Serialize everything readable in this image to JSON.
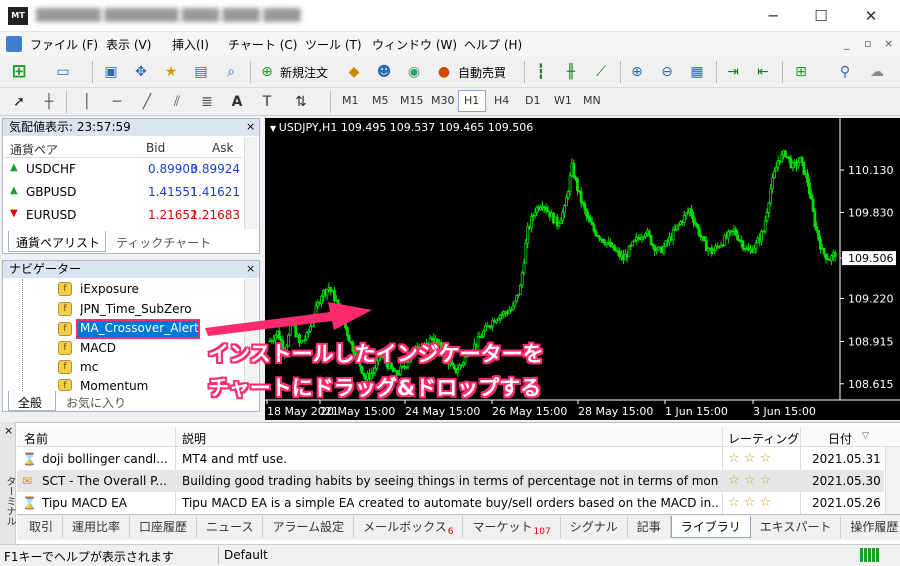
{
  "window": {
    "minimize": "─",
    "maximize": "☐",
    "close": "✕"
  },
  "menu": [
    "ファイル (F)",
    "表示 (V)",
    "挿入(I)",
    "チャート (C)",
    "ツール (T)",
    "ウィンドウ (W)",
    "ヘルプ (H)"
  ],
  "mdi": [
    "_",
    "▫",
    "×"
  ],
  "toolbar": {
    "new_order": "新規注文",
    "auto_trade": "自動売買"
  },
  "timeframes": [
    "M1",
    "M5",
    "M15",
    "M30",
    "H1",
    "H4",
    "D1",
    "W1",
    "MN"
  ],
  "active_timeframe": "H1",
  "market_watch": {
    "title": "気配値表示: 23:57:59",
    "col_pair": "通貨ペア",
    "col_bid": "Bid",
    "col_ask": "Ask",
    "rows": [
      {
        "pair": "USDCHF",
        "bid": "0.89903",
        "ask": "0.89924",
        "dir": "up"
      },
      {
        "pair": "GBPUSD",
        "bid": "1.41551",
        "ask": "1.41621",
        "dir": "up"
      },
      {
        "pair": "EURUSD",
        "bid": "1.21652",
        "ask": "1.21683",
        "dir": "down"
      }
    ],
    "tab1": "通貨ペアリスト",
    "tab2": "ティックチャート"
  },
  "navigator": {
    "title": "ナビゲーター",
    "items": [
      "iExposure",
      "JPN_Time_SubZero",
      "MA_Crossover_Alert",
      "MACD",
      "mc",
      "Momentum"
    ],
    "selected": "MA_Crossover_Alert",
    "tab1": "全般",
    "tab2": "お気に入り"
  },
  "chart_data": {
    "type": "candlestick",
    "symbol_line": "USDJPY,H1  109.495 109.537 109.465 109.506",
    "y_ticks": [
      "110.130",
      "109.830",
      "109.506",
      "109.220",
      "108.915",
      "108.615"
    ],
    "y_tick_values": [
      110.13,
      109.83,
      109.506,
      109.22,
      108.915,
      108.615
    ],
    "ylim": [
      108.5,
      110.4
    ],
    "x_ticks": [
      "18 May 2021",
      "20 May 15:00",
      "24 May 15:00",
      "26 May 15:00",
      "28 May 15:00",
      "1 Jun 15:00",
      "3 Jun 15:00"
    ],
    "current_price": "109.506",
    "series": [
      108.92,
      108.98,
      108.85,
      109.05,
      108.9,
      108.95,
      109.1,
      109.25,
      109.3,
      109.2,
      109.05,
      108.9,
      108.78,
      108.65,
      108.7,
      108.82,
      108.75,
      108.68,
      108.72,
      108.8,
      108.9,
      108.85,
      108.95,
      108.88,
      108.8,
      108.7,
      108.75,
      108.85,
      108.9,
      108.98,
      109.05,
      109.1,
      109.12,
      109.15,
      109.3,
      109.7,
      109.85,
      109.9,
      109.82,
      109.75,
      109.85,
      110.15,
      109.95,
      109.8,
      109.7,
      109.65,
      109.6,
      109.55,
      109.5,
      109.58,
      109.65,
      109.7,
      109.6,
      109.55,
      109.62,
      109.7,
      109.78,
      109.85,
      109.72,
      109.6,
      109.55,
      109.6,
      109.65,
      109.7,
      109.62,
      109.55,
      109.6,
      109.7,
      110.0,
      110.2,
      110.25,
      110.15,
      110.2,
      110.05,
      109.75,
      109.55,
      109.5,
      109.55
    ]
  },
  "annotation": {
    "line1": "インストールしたインジケーターを",
    "line2": "チャートにドラッグ&ドロップする"
  },
  "terminal": {
    "side_label": "ターミナル",
    "col_name": "名前",
    "col_desc": "説明",
    "col_rating": "レーティング",
    "col_date": "日付",
    "rows": [
      {
        "name": "doji bollinger candl...",
        "desc": "MT4 and mtf use.",
        "date": "2021.05.31"
      },
      {
        "name": "SCT - The Overall P...",
        "desc": "Building good trading habits by seeing things in terms of percentage not in terms of mon...",
        "date": "2021.05.30"
      },
      {
        "name": "Tipu MACD EA",
        "desc": "Tipu MACD EA is a simple EA created to automate buy/sell orders based on the MACD in...",
        "date": "2021.05.26"
      }
    ],
    "tabs": [
      {
        "label": "取引"
      },
      {
        "label": "運用比率"
      },
      {
        "label": "口座履歴"
      },
      {
        "label": "ニュース"
      },
      {
        "label": "アラーム設定"
      },
      {
        "label": "メールボックス",
        "badge": "6"
      },
      {
        "label": "マーケット",
        "badge": "107"
      },
      {
        "label": "シグナル"
      },
      {
        "label": "記事"
      },
      {
        "label": "ライブラリ"
      },
      {
        "label": "エキスパート"
      },
      {
        "label": "操作履歴"
      }
    ],
    "active_tab": "ライブラリ"
  },
  "status": {
    "help": "F1キーでヘルプが表示されます",
    "profile": "Default"
  },
  "colors": {
    "bid_blue": "#1a3fd6",
    "ask_red": "#e00000",
    "candle_green": "#00e000",
    "annotation_pink": "#ff2a6d"
  }
}
